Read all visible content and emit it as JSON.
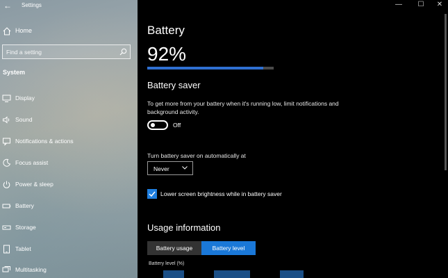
{
  "window": {
    "title": "Settings",
    "back_glyph": "←",
    "minimize_glyph": "—",
    "maximize_glyph": "☐",
    "close_glyph": "✕"
  },
  "sidebar": {
    "home_label": "Home",
    "search_placeholder": "Find a setting",
    "section_title": "System",
    "items": [
      {
        "label": "Display",
        "icon": "display-icon"
      },
      {
        "label": "Sound",
        "icon": "sound-icon"
      },
      {
        "label": "Notifications & actions",
        "icon": "notifications-icon"
      },
      {
        "label": "Focus assist",
        "icon": "focus-assist-icon"
      },
      {
        "label": "Power & sleep",
        "icon": "power-icon"
      },
      {
        "label": "Battery",
        "icon": "battery-icon"
      },
      {
        "label": "Storage",
        "icon": "storage-icon"
      },
      {
        "label": "Tablet",
        "icon": "tablet-icon"
      },
      {
        "label": "Multitasking",
        "icon": "multitasking-icon"
      }
    ]
  },
  "main": {
    "title": "Battery",
    "percent_text": "92%",
    "charge_fraction": 0.92,
    "battery_saver": {
      "heading": "Battery saver",
      "description": "To get more from your battery when it's running low, limit notifications and background activity.",
      "toggle_label": "Off",
      "toggle_on": false,
      "auto_label": "Turn battery saver on automatically at",
      "auto_value": "Never",
      "brightness_label": "Lower screen brightness while in battery saver",
      "brightness_checked": true
    },
    "usage": {
      "heading": "Usage information",
      "tab_usage": "Battery usage",
      "tab_level": "Battery level",
      "chart_label": "Battery level (%)"
    }
  },
  "colors": {
    "accent": "#1a78d8",
    "progress": "#2f6fd1",
    "background": "#000000"
  }
}
